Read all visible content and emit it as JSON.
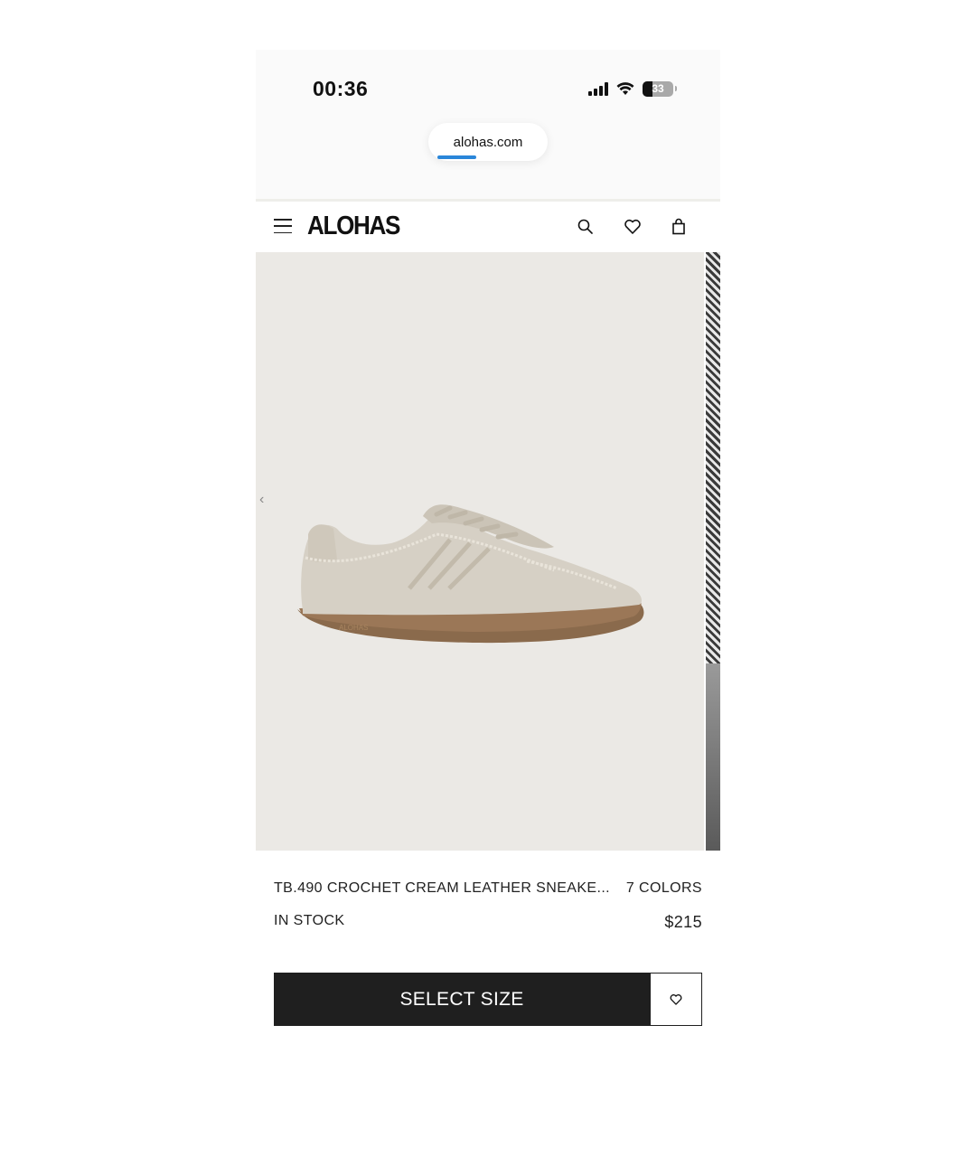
{
  "status_bar": {
    "time": "00:36",
    "battery": "33"
  },
  "browser": {
    "url": "alohas.com"
  },
  "site_header": {
    "logo": "ALOHAS",
    "icons": [
      "menu-icon",
      "search-icon",
      "heart-icon",
      "shopping-bag-icon"
    ]
  },
  "product": {
    "name": "TB.490 CROCHET CREAM LEATHER SNEAKE...",
    "colors": "7 COLORS",
    "stock": "IN STOCK",
    "price": "$215",
    "image_logo_text": "ALOHAS"
  },
  "actions": {
    "select_size_label": "SELECT SIZE"
  },
  "colors": {
    "cta_background": "#1f1f1f",
    "image_background": "#ebe9e5",
    "progress_accent": "#2a86d9"
  }
}
